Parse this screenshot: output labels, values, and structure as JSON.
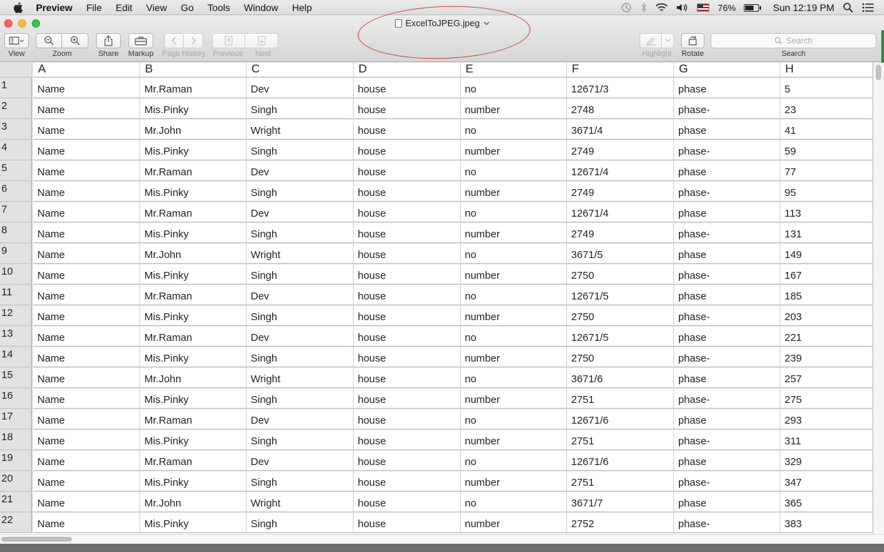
{
  "menubar": {
    "app_name": "Preview",
    "items": [
      "File",
      "Edit",
      "View",
      "Go",
      "Tools",
      "Window",
      "Help"
    ],
    "battery_percent": "76%",
    "clock": "Sun 12:19 PM"
  },
  "window": {
    "title": "ExcelToJPEG.jpeg",
    "annotation_color": "#d63b3b"
  },
  "toolbar": {
    "view_label": "View",
    "zoom_label": "Zoom",
    "share_label": "Share",
    "markup_label": "Markup",
    "page_history_label": "Page History",
    "previous_label": "Previous",
    "next_label": "Next",
    "highlight_label": "Highlight",
    "rotate_label": "Rotate",
    "search_placeholder": "Search",
    "search_label": "Search"
  },
  "sheet": {
    "columns": [
      "A",
      "B",
      "C",
      "D",
      "E",
      "F",
      "G",
      "H"
    ],
    "rows": [
      {
        "n": "1",
        "cells": [
          "Name",
          "Mr.Raman",
          "Dev",
          "house",
          "no",
          "12671/3",
          "phase",
          "5"
        ]
      },
      {
        "n": "2",
        "cells": [
          "Name",
          "Mis.Pinky",
          "Singh",
          "house",
          "number",
          "2748",
          "phase-",
          "23"
        ]
      },
      {
        "n": "3",
        "cells": [
          "Name",
          "Mr.John",
          "Wright",
          "house",
          "no",
          "3671/4",
          "phase",
          "41"
        ]
      },
      {
        "n": "4",
        "cells": [
          "Name",
          "Mis.Pinky",
          "Singh",
          "house",
          "number",
          "2749",
          "phase-",
          "59"
        ]
      },
      {
        "n": "5",
        "cells": [
          "Name",
          "Mr.Raman",
          "Dev",
          "house",
          "no",
          "12671/4",
          "phase",
          "77"
        ]
      },
      {
        "n": "6",
        "cells": [
          "Name",
          "Mis.Pinky",
          "Singh",
          "house",
          "number",
          "2749",
          "phase-",
          "95"
        ]
      },
      {
        "n": "7",
        "cells": [
          "Name",
          "Mr.Raman",
          "Dev",
          "house",
          "no",
          "12671/4",
          "phase",
          "113"
        ]
      },
      {
        "n": "8",
        "cells": [
          "Name",
          "Mis.Pinky",
          "Singh",
          "house",
          "number",
          "2749",
          "phase-",
          "131"
        ]
      },
      {
        "n": "9",
        "cells": [
          "Name",
          "Mr.John",
          "Wright",
          "house",
          "no",
          "3671/5",
          "phase",
          "149"
        ]
      },
      {
        "n": "10",
        "cells": [
          "Name",
          "Mis.Pinky",
          "Singh",
          "house",
          "number",
          "2750",
          "phase-",
          "167"
        ]
      },
      {
        "n": "11",
        "cells": [
          "Name",
          "Mr.Raman",
          "Dev",
          "house",
          "no",
          "12671/5",
          "phase",
          "185"
        ]
      },
      {
        "n": "12",
        "cells": [
          "Name",
          "Mis.Pinky",
          "Singh",
          "house",
          "number",
          "2750",
          "phase-",
          "203"
        ]
      },
      {
        "n": "13",
        "cells": [
          "Name",
          "Mr.Raman",
          "Dev",
          "house",
          "no",
          "12671/5",
          "phase",
          "221"
        ]
      },
      {
        "n": "14",
        "cells": [
          "Name",
          "Mis.Pinky",
          "Singh",
          "house",
          "number",
          "2750",
          "phase-",
          "239"
        ]
      },
      {
        "n": "15",
        "cells": [
          "Name",
          "Mr.John",
          "Wright",
          "house",
          "no",
          "3671/6",
          "phase",
          "257"
        ]
      },
      {
        "n": "16",
        "cells": [
          "Name",
          "Mis.Pinky",
          "Singh",
          "house",
          "number",
          "2751",
          "phase-",
          "275"
        ]
      },
      {
        "n": "17",
        "cells": [
          "Name",
          "Mr.Raman",
          "Dev",
          "house",
          "no",
          "12671/6",
          "phase",
          "293"
        ]
      },
      {
        "n": "18",
        "cells": [
          "Name",
          "Mis.Pinky",
          "Singh",
          "house",
          "number",
          "2751",
          "phase-",
          "311"
        ]
      },
      {
        "n": "19",
        "cells": [
          "Name",
          "Mr.Raman",
          "Dev",
          "house",
          "no",
          "12671/6",
          "phase",
          "329"
        ]
      },
      {
        "n": "20",
        "cells": [
          "Name",
          "Mis.Pinky",
          "Singh",
          "house",
          "number",
          "2751",
          "phase-",
          "347"
        ]
      },
      {
        "n": "21",
        "cells": [
          "Name",
          "Mr.John",
          "Wright",
          "house",
          "no",
          "3671/7",
          "phase",
          "365"
        ]
      },
      {
        "n": "22",
        "cells": [
          "Name",
          "Mis.Pinky",
          "Singh",
          "house",
          "number",
          "2752",
          "phase-",
          "383"
        ]
      }
    ]
  }
}
